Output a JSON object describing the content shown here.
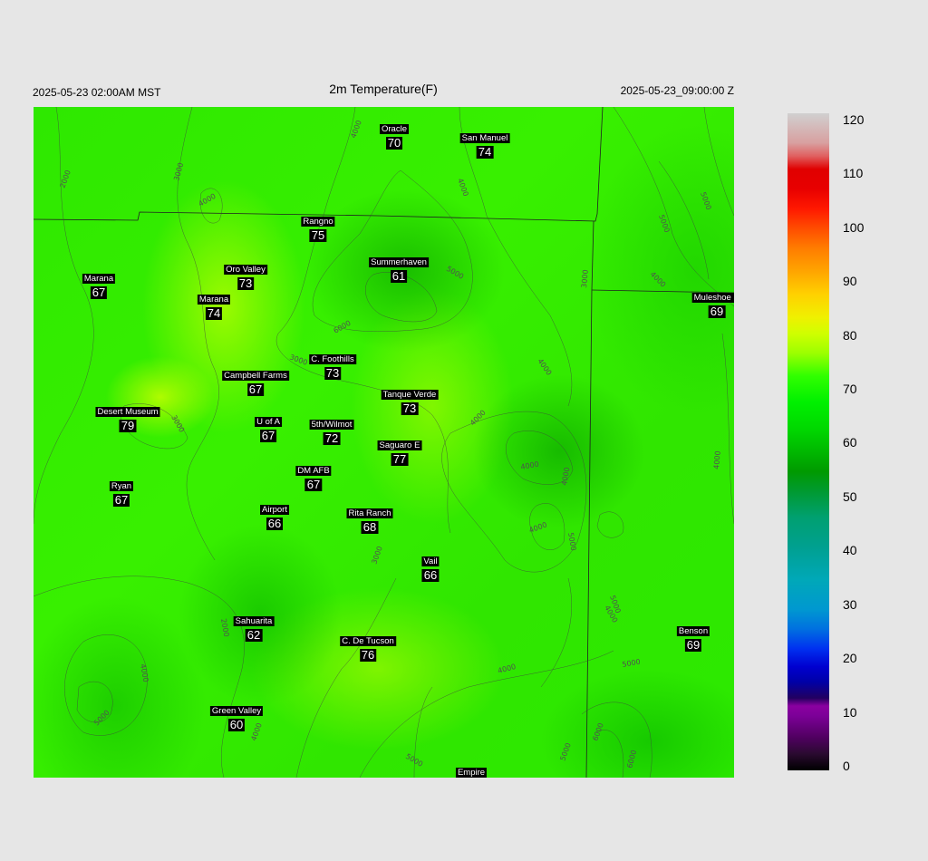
{
  "header": {
    "valid_time": "2025-05-23 02:00AM MST",
    "title": "2m Temperature(F)",
    "forecast_time": "2025-05-23_09:00:00 Z"
  },
  "stations": [
    {
      "id": "oracle",
      "name": "Oracle",
      "value": "70"
    },
    {
      "id": "san-manuel",
      "name": "San Manuel",
      "value": "74"
    },
    {
      "id": "rangno",
      "name": "Rangno",
      "value": "75"
    },
    {
      "id": "summerhaven",
      "name": "Summerhaven",
      "value": "61"
    },
    {
      "id": "marana-west",
      "name": "Marana",
      "value": "67"
    },
    {
      "id": "oro-valley",
      "name": "Oro Valley",
      "value": "73"
    },
    {
      "id": "marana",
      "name": "Marana",
      "value": "74"
    },
    {
      "id": "muleshoe",
      "name": "Muleshoe R",
      "value": "69"
    },
    {
      "id": "c-foothills",
      "name": "C. Foothills",
      "value": "73"
    },
    {
      "id": "campbell-farms",
      "name": "Campbell Farms",
      "value": "67"
    },
    {
      "id": "tanque-verde",
      "name": "Tanque Verde",
      "value": "73"
    },
    {
      "id": "desert-museum",
      "name": "Desert Museum",
      "value": "79"
    },
    {
      "id": "u-of-a",
      "name": "U of A",
      "value": "67"
    },
    {
      "id": "5th-wilmot",
      "name": "5th/Wilmot",
      "value": "72"
    },
    {
      "id": "saguaro-e",
      "name": "Saguaro E",
      "value": "77"
    },
    {
      "id": "dm-afb",
      "name": "DM AFB",
      "value": "67"
    },
    {
      "id": "ryan",
      "name": "Ryan",
      "value": "67"
    },
    {
      "id": "airport",
      "name": "Airport",
      "value": "66"
    },
    {
      "id": "rita-ranch",
      "name": "Rita Ranch",
      "value": "68"
    },
    {
      "id": "vail",
      "name": "Vail",
      "value": "66"
    },
    {
      "id": "sahuarita",
      "name": "Sahuarita",
      "value": "62"
    },
    {
      "id": "c-de-tucson",
      "name": "C. De Tucson",
      "value": "76"
    },
    {
      "id": "benson",
      "name": "Benson",
      "value": "69"
    },
    {
      "id": "green-valley",
      "name": "Green Valley",
      "value": "60"
    },
    {
      "id": "empire",
      "name": "Empire",
      "value": ""
    }
  ],
  "contour_labels": [
    "2000",
    "3000",
    "4000",
    "4000",
    "4000",
    "4000",
    "5000",
    "5000",
    "5000",
    "6000",
    "3000",
    "3000",
    "4000",
    "3000",
    "4000",
    "4000",
    "4000",
    "4000",
    "5000",
    "5000",
    "4000",
    "2000",
    "4000",
    "3000",
    "5000",
    "4000",
    "5000",
    "6000",
    "5000",
    "4000",
    "4000",
    "5000",
    "6000"
  ],
  "colorbar": {
    "labels": [
      "120",
      "110",
      "100",
      "90",
      "80",
      "70",
      "60",
      "50",
      "40",
      "30",
      "20",
      "10",
      "0"
    ]
  }
}
